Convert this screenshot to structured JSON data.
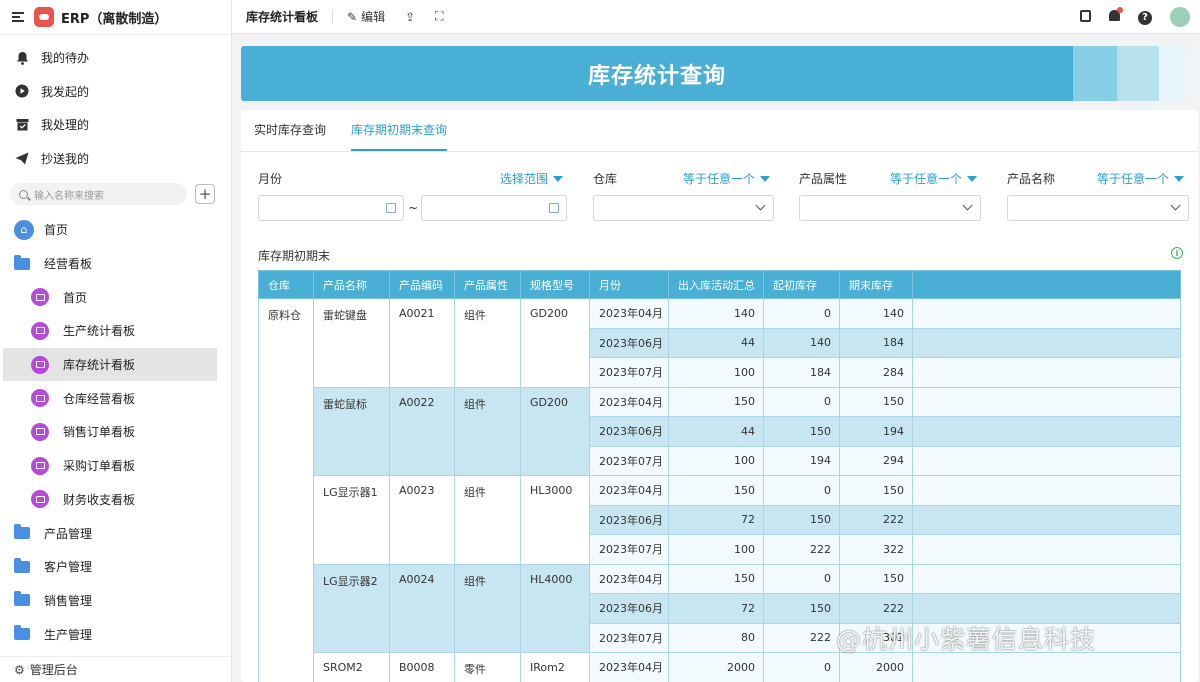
{
  "app": {
    "title": "ERP（离散制造）"
  },
  "sidebar": {
    "quick": [
      {
        "label": "我的待办",
        "icon": "bell-icon"
      },
      {
        "label": "我发起的",
        "icon": "play-icon"
      },
      {
        "label": "我处理的",
        "icon": "inbox-icon"
      },
      {
        "label": "抄送我的",
        "icon": "send-icon"
      }
    ],
    "search_placeholder": "输入名称来搜索",
    "nav": [
      {
        "label": "首页",
        "type": "home"
      },
      {
        "label": "经营看板",
        "type": "folder"
      },
      {
        "label": "首页",
        "type": "dash"
      },
      {
        "label": "生产统计看板",
        "type": "dash"
      },
      {
        "label": "库存统计看板",
        "type": "dash",
        "active": true
      },
      {
        "label": "仓库经营看板",
        "type": "dash"
      },
      {
        "label": "销售订单看板",
        "type": "dash"
      },
      {
        "label": "采购订单看板",
        "type": "dash"
      },
      {
        "label": "财务收支看板",
        "type": "dash"
      },
      {
        "label": "产品管理",
        "type": "folder"
      },
      {
        "label": "客户管理",
        "type": "folder"
      },
      {
        "label": "销售管理",
        "type": "folder"
      },
      {
        "label": "生产管理",
        "type": "folder"
      }
    ],
    "admin_label": "管理后台"
  },
  "topbar": {
    "page_title": "库存统计看板",
    "edit_label": "编辑"
  },
  "banner": {
    "title": "库存统计查询"
  },
  "tabs": [
    {
      "label": "实时库存查询",
      "active": false
    },
    {
      "label": "库存期初期末查询",
      "active": true
    }
  ],
  "filters": {
    "month": {
      "label": "月份",
      "op": "选择范围",
      "sep": "~"
    },
    "warehouse": {
      "label": "仓库",
      "op": "等于任意一个"
    },
    "attr": {
      "label": "产品属性",
      "op": "等于任意一个"
    },
    "name": {
      "label": "产品名称",
      "op": "等于任意一个"
    }
  },
  "section_title": "库存期初期末",
  "table": {
    "headers": [
      "仓库",
      "产品名称",
      "产品编码",
      "产品属性",
      "规格型号",
      "月份",
      "出入库活动汇总",
      "起初库存",
      "期末库存"
    ],
    "warehouse": "原料仓",
    "groups": [
      {
        "name": "雷蛇键盘",
        "code": "A0021",
        "attr": "组件",
        "spec": "GD200",
        "rows": [
          {
            "month": "2023年04月",
            "activity": "140",
            "start": "0",
            "end": "140"
          },
          {
            "month": "2023年06月",
            "activity": "44",
            "start": "140",
            "end": "184"
          },
          {
            "month": "2023年07月",
            "activity": "100",
            "start": "184",
            "end": "284"
          }
        ]
      },
      {
        "name": "雷蛇鼠标",
        "code": "A0022",
        "attr": "组件",
        "spec": "GD200",
        "rows": [
          {
            "month": "2023年04月",
            "activity": "150",
            "start": "0",
            "end": "150"
          },
          {
            "month": "2023年06月",
            "activity": "44",
            "start": "150",
            "end": "194"
          },
          {
            "month": "2023年07月",
            "activity": "100",
            "start": "194",
            "end": "294"
          }
        ]
      },
      {
        "name": "LG显示器1",
        "code": "A0023",
        "attr": "组件",
        "spec": "HL3000",
        "rows": [
          {
            "month": "2023年04月",
            "activity": "150",
            "start": "0",
            "end": "150"
          },
          {
            "month": "2023年06月",
            "activity": "72",
            "start": "150",
            "end": "222"
          },
          {
            "month": "2023年07月",
            "activity": "100",
            "start": "222",
            "end": "322"
          }
        ]
      },
      {
        "name": "LG显示器2",
        "code": "A0024",
        "attr": "组件",
        "spec": "HL4000",
        "rows": [
          {
            "month": "2023年04月",
            "activity": "150",
            "start": "0",
            "end": "150"
          },
          {
            "month": "2023年06月",
            "activity": "72",
            "start": "150",
            "end": "222"
          },
          {
            "month": "2023年07月",
            "activity": "80",
            "start": "222",
            "end": "302"
          }
        ]
      },
      {
        "name": "SROM2",
        "code": "B0008",
        "attr": "零件",
        "spec": "IRom2",
        "rows": [
          {
            "month": "2023年04月",
            "activity": "2000",
            "start": "0",
            "end": "2000"
          }
        ]
      }
    ]
  },
  "watermark": "@杭州小紫薯信息科技"
}
